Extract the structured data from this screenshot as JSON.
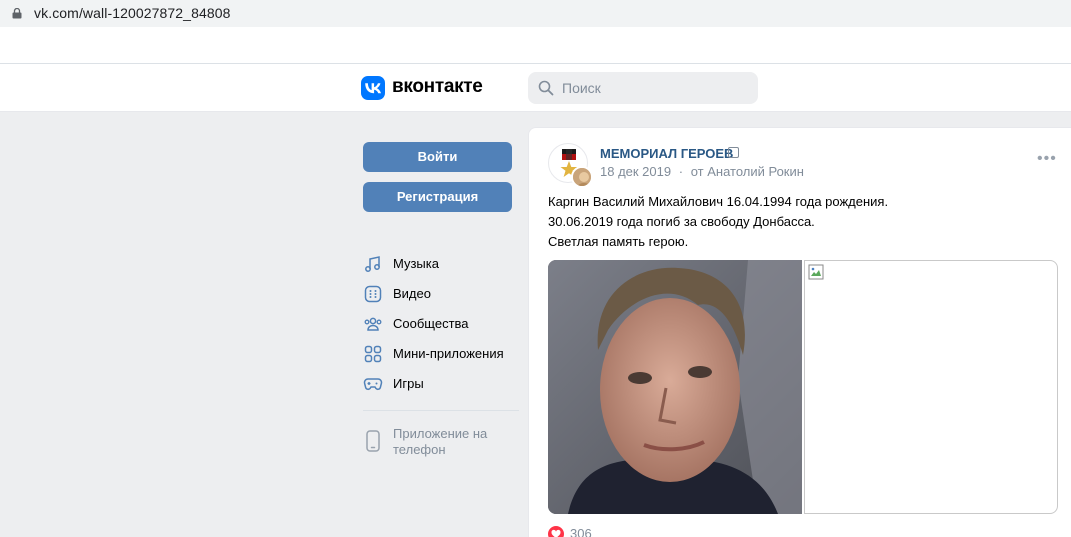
{
  "browser": {
    "url": "vk.com/wall-120027872_84808"
  },
  "header": {
    "brand": "вконтакте",
    "search_placeholder": "Поиск",
    "logo_icon": "vk-logo-icon",
    "accent": "#0077ff"
  },
  "sidebar": {
    "login_label": "Войти",
    "register_label": "Регистрация",
    "button_color": "#5181b8",
    "items": [
      {
        "label": "Музыка",
        "icon": "music-icon"
      },
      {
        "label": "Видео",
        "icon": "video-icon"
      },
      {
        "label": "Сообщества",
        "icon": "communities-icon"
      },
      {
        "label": "Мини-приложения",
        "icon": "mini-apps-icon"
      },
      {
        "label": "Игры",
        "icon": "gamepad-icon"
      }
    ],
    "app_label": "Приложение на телефон"
  },
  "post": {
    "author": "МЕМОРИАЛ ГЕРОЕВ",
    "date": "18 дек 2019",
    "separator": "·",
    "from": "от Анатолий Рокин",
    "lines": [
      "Каргин Василий Михайлович 16.04.1994 года рождения.",
      "30.06.2019 года погиб за свободу Донбасса.",
      "Светлая память герою."
    ],
    "likes": "306",
    "link_color": "#2a5885"
  }
}
